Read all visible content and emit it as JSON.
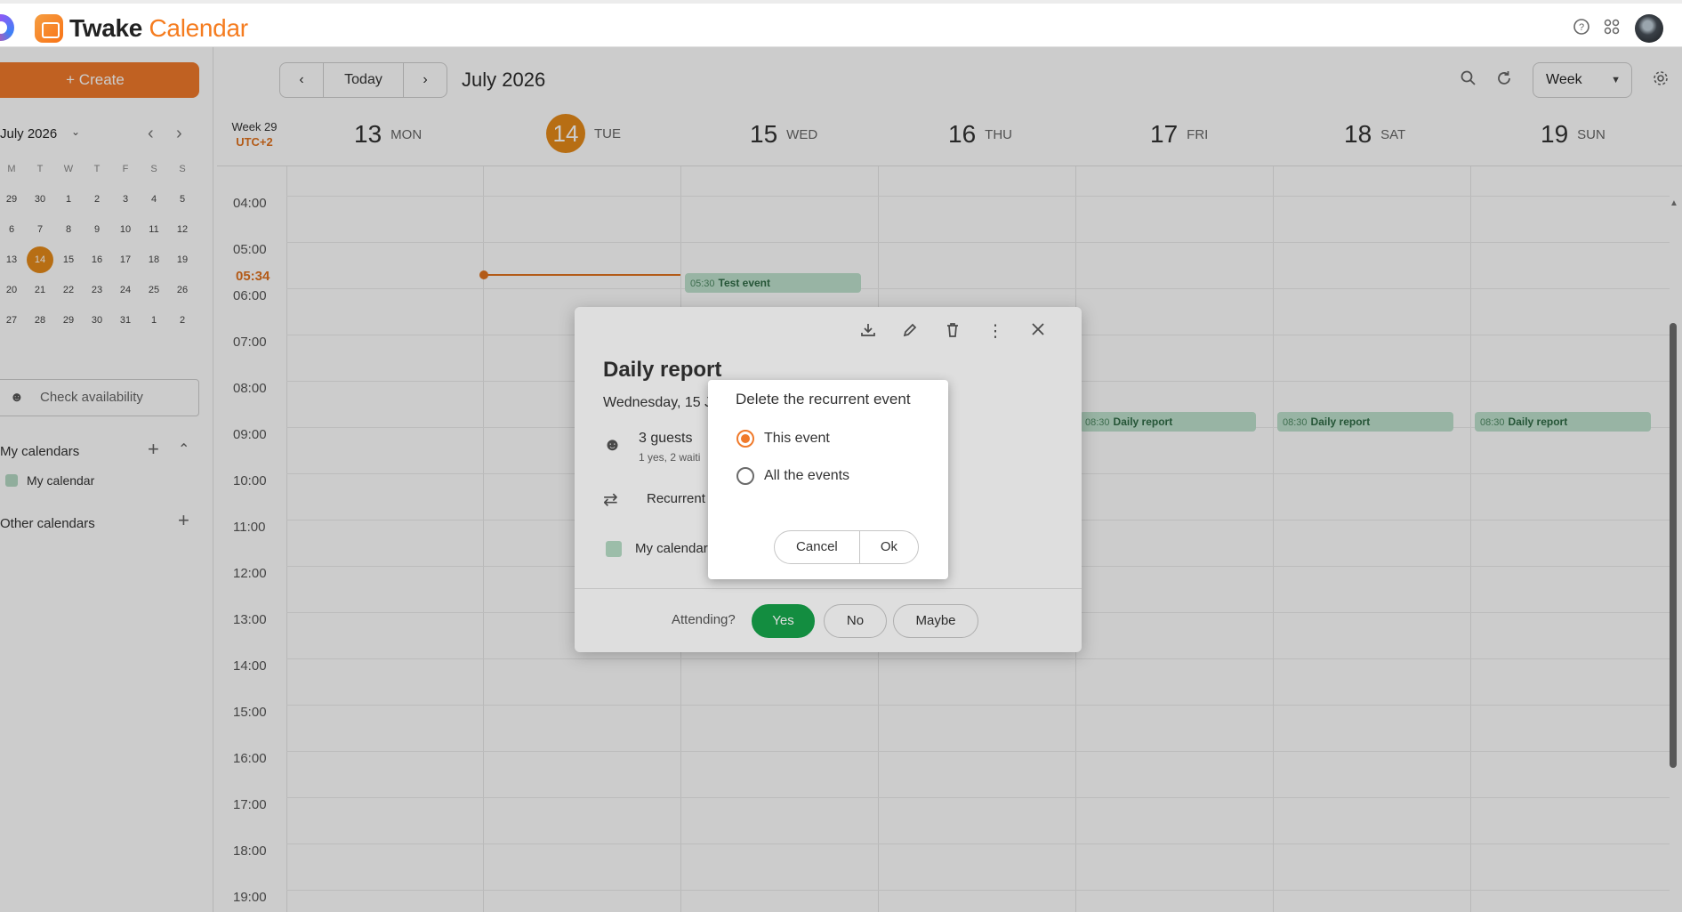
{
  "app": {
    "brand_part1": "Twake",
    "brand_part2": "Calendar"
  },
  "toolbar": {
    "create_label": "+ Create",
    "today_label": "Today",
    "month_title": "July 2026",
    "view_label": "Week"
  },
  "mini_calendar": {
    "title": "July 2026",
    "weekdays": [
      "M",
      "T",
      "W",
      "T",
      "F",
      "S",
      "S"
    ],
    "weeks": [
      [
        "29",
        "30",
        "1",
        "2",
        "3",
        "4",
        "5"
      ],
      [
        "6",
        "7",
        "8",
        "9",
        "10",
        "11",
        "12"
      ],
      [
        "13",
        "14",
        "15",
        "16",
        "17",
        "18",
        "19"
      ],
      [
        "20",
        "21",
        "22",
        "23",
        "24",
        "25",
        "26"
      ],
      [
        "27",
        "28",
        "29",
        "30",
        "31",
        "1",
        "2"
      ]
    ],
    "today": "14"
  },
  "sidebar": {
    "check_availability": "Check availability",
    "my_calendars_title": "My calendars",
    "my_calendar_item": "My calendar",
    "other_calendars_title": "Other calendars"
  },
  "week": {
    "week_label": "Week 29",
    "timezone": "UTC+2",
    "days": [
      {
        "num": "13",
        "name": "MON"
      },
      {
        "num": "14",
        "name": "TUE"
      },
      {
        "num": "15",
        "name": "WED"
      },
      {
        "num": "16",
        "name": "THU"
      },
      {
        "num": "17",
        "name": "FRI"
      },
      {
        "num": "18",
        "name": "SAT"
      },
      {
        "num": "19",
        "name": "SUN"
      }
    ],
    "hours": [
      "04:00",
      "05:00",
      "06:00",
      "07:00",
      "08:00",
      "09:00",
      "10:00",
      "11:00",
      "12:00",
      "13:00",
      "14:00",
      "15:00",
      "16:00",
      "17:00",
      "18:00",
      "19:00"
    ],
    "now_time": "05:34"
  },
  "events": {
    "test": {
      "time": "05:30",
      "name": "Test event"
    },
    "daily_fri": {
      "time": "08:30",
      "name": "Daily report"
    },
    "daily_sat": {
      "time": "08:30",
      "name": "Daily report"
    },
    "daily_sun": {
      "time": "08:30",
      "name": "Daily report"
    }
  },
  "event_card": {
    "title": "Daily report",
    "date": "Wednesday, 15 J",
    "guests": "3 guests",
    "guests_sub": "1 yes, 2 waiti",
    "recurrence": "Recurrent",
    "calendar": "My calendar",
    "attending_label": "Attending?",
    "yes_label": "Yes",
    "no_label": "No",
    "maybe_label": "Maybe"
  },
  "delete_dialog": {
    "title": "Delete the recurrent event",
    "option_this": "This event",
    "option_all": "All the events",
    "selected": "This event",
    "cancel_label": "Cancel",
    "ok_label": "Ok"
  },
  "colors": {
    "accent": "#f07a2b",
    "today": "#e58a1a",
    "event_bg": "#bfe2cd",
    "yes_green": "#16a34a"
  }
}
